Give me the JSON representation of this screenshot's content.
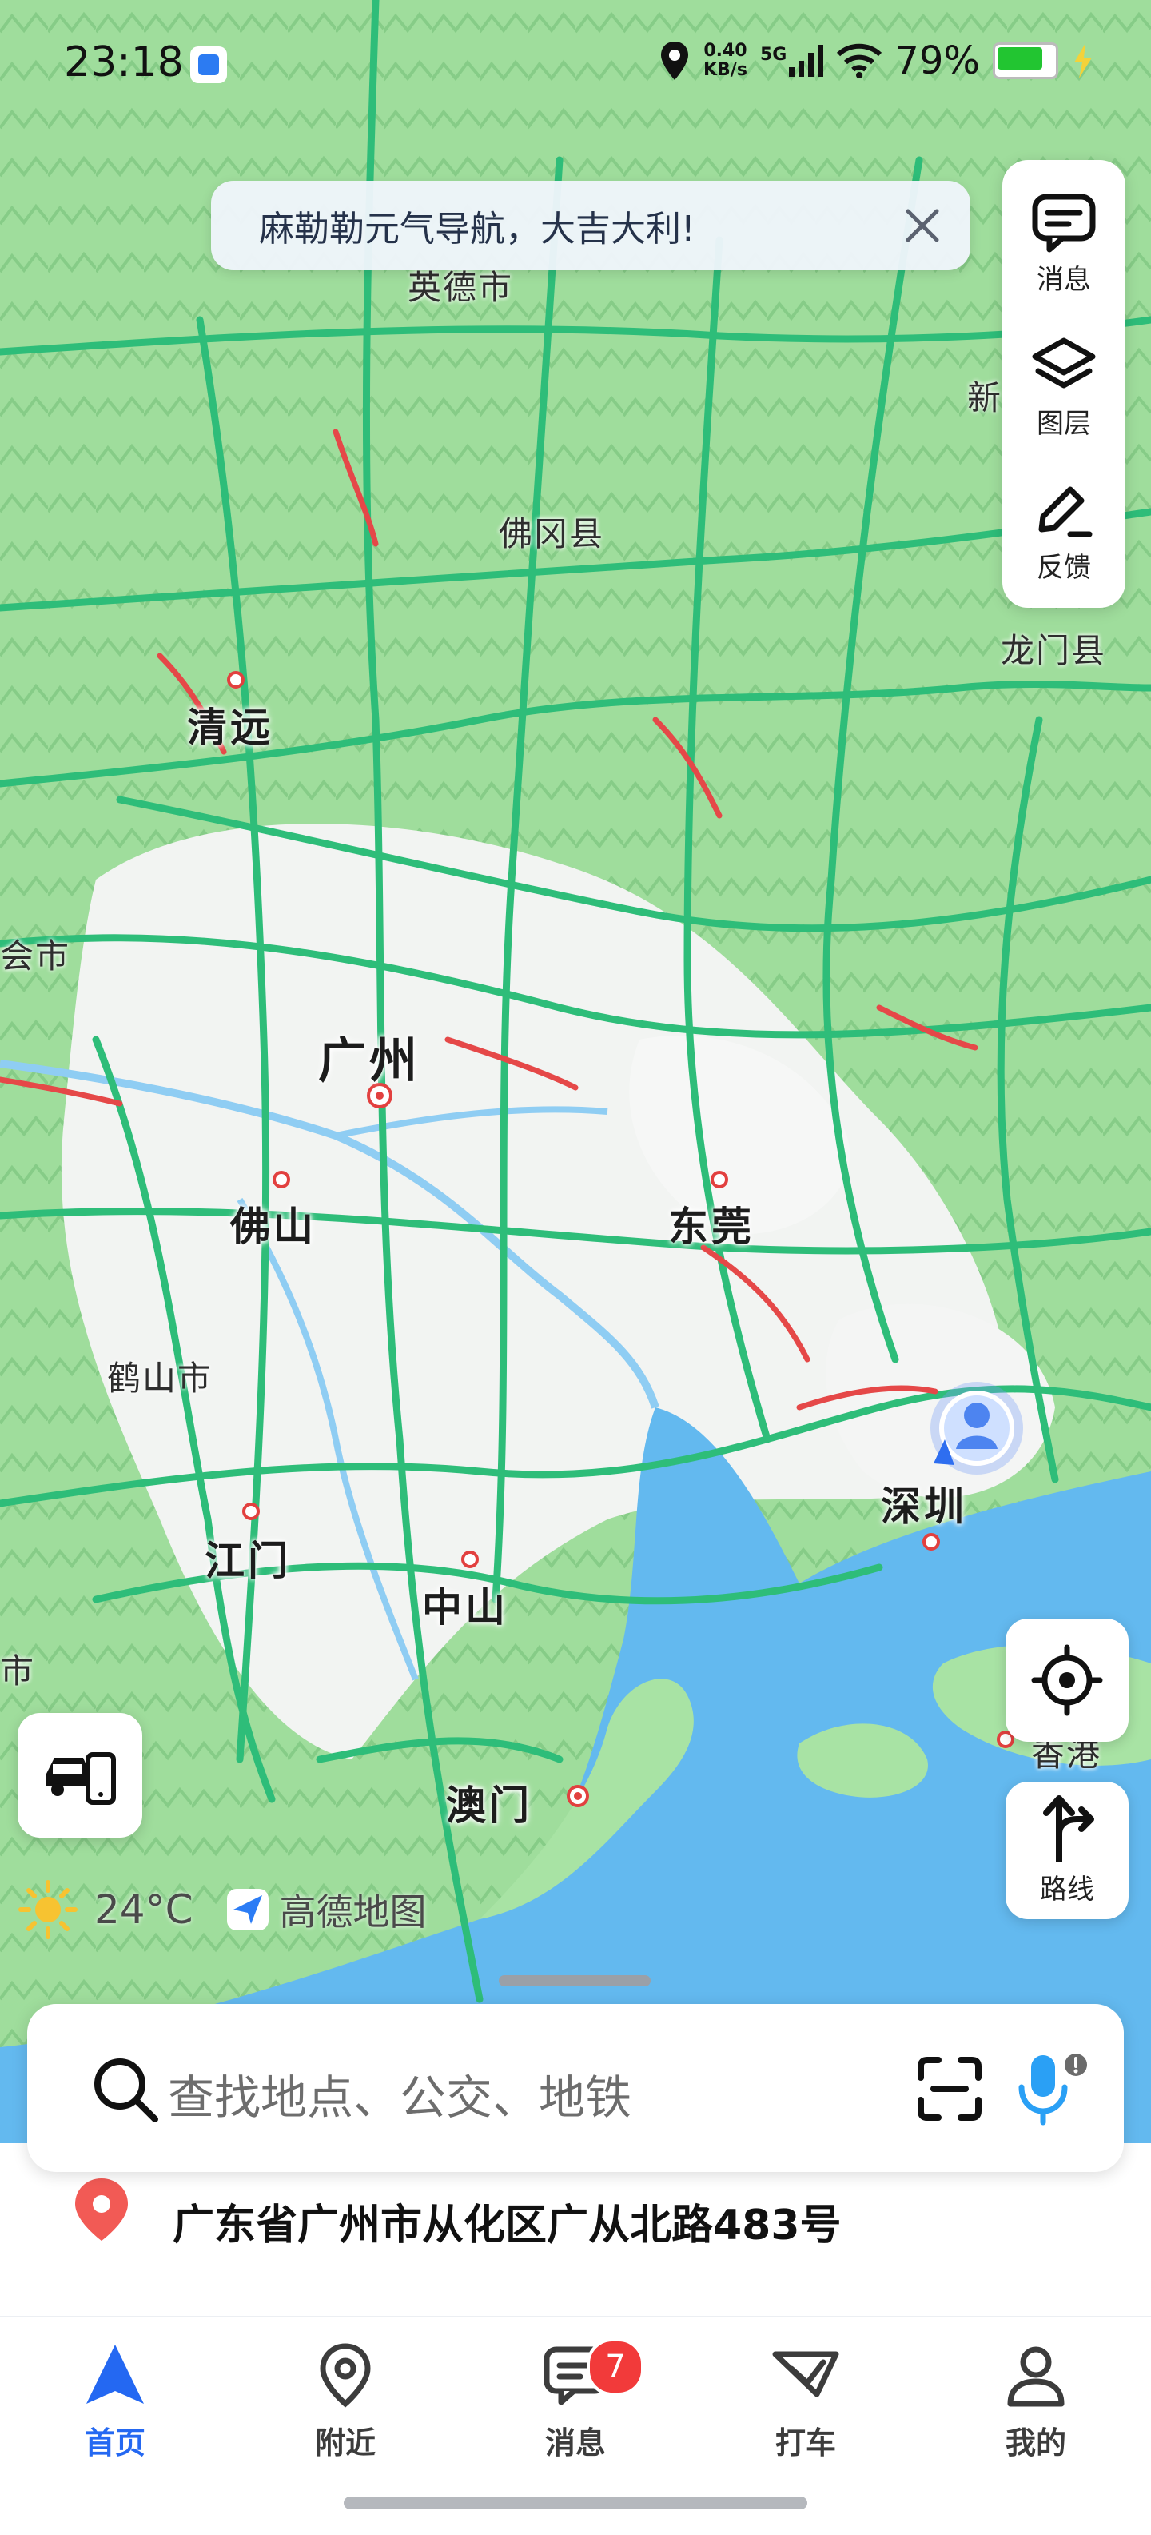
{
  "status_bar": {
    "time": "23:18",
    "speed": "0.40",
    "speed_unit": "KB/s",
    "network": "5G",
    "battery": "79%"
  },
  "banner": {
    "text": "麻勒勒元气导航，大吉大利!"
  },
  "side_panel": {
    "items": [
      {
        "label": "消息",
        "icon": "message-icon"
      },
      {
        "label": "图层",
        "icon": "layers-icon"
      },
      {
        "label": "反馈",
        "icon": "feedback-pen-icon"
      }
    ]
  },
  "map": {
    "cities": [
      {
        "name": "广州"
      },
      {
        "name": "佛山"
      },
      {
        "name": "东莞"
      },
      {
        "name": "深圳"
      },
      {
        "name": "中山"
      },
      {
        "name": "江门"
      },
      {
        "name": "澳门"
      },
      {
        "name": "清远"
      }
    ],
    "towns": [
      {
        "name": "英德市"
      },
      {
        "name": "佛冈县"
      },
      {
        "name": "龙门县"
      },
      {
        "name": "鹤山市"
      },
      {
        "name": "新"
      },
      {
        "name": "会市"
      },
      {
        "name": "市"
      },
      {
        "name": "香港"
      }
    ],
    "colors": {
      "land": "#a8e3a4",
      "forest": "#8fd38f",
      "urban": "#f4f6f4",
      "water": "#62b8ef",
      "road": "#2dbf7a",
      "congestion": "#e84a4a"
    }
  },
  "controls": {
    "route_label": "路线",
    "locate_icon": "crosshair-icon",
    "car_icon": "car-phone-icon"
  },
  "weather": {
    "temp": "24°C",
    "brand": "高德地图"
  },
  "search": {
    "placeholder": "查找地点、公交、地铁"
  },
  "address": {
    "text": "广东省广州市从化区广从北路483号"
  },
  "tabs": [
    {
      "label": "首页",
      "icon": "navigation-arrow-icon",
      "active": true
    },
    {
      "label": "附近",
      "icon": "location-pin-icon"
    },
    {
      "label": "消息",
      "icon": "message-icon",
      "badge": "7"
    },
    {
      "label": "打车",
      "icon": "taxi-icon"
    },
    {
      "label": "我的",
      "icon": "profile-icon"
    }
  ]
}
